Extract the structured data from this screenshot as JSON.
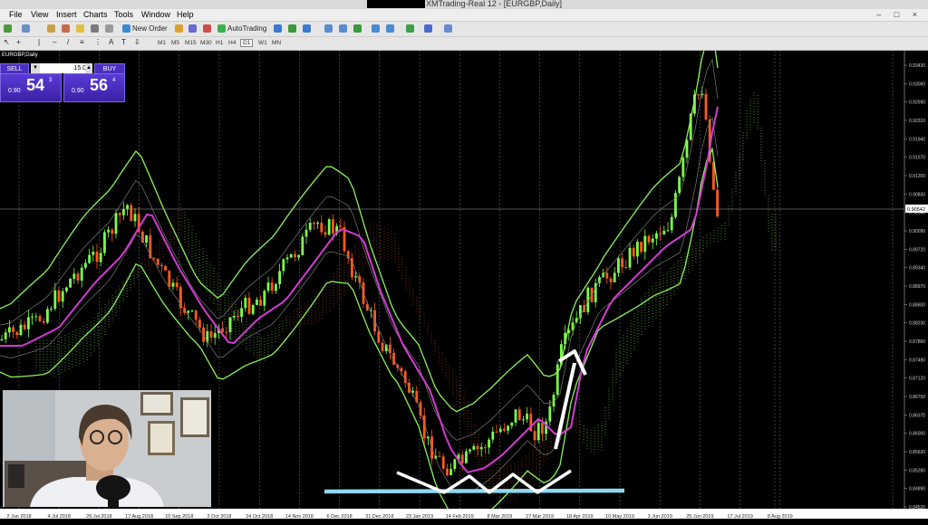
{
  "window": {
    "title": "XMTrading-Real 12 - [EURGBP,Daily]",
    "controls": "– □ ×"
  },
  "menu": [
    "File",
    "View",
    "Insert",
    "Charts",
    "Tools",
    "Window",
    "Help"
  ],
  "toolbar": {
    "new_order": "New Order",
    "autotrading": "AutoTrading",
    "timeframes": [
      "M1",
      "M5",
      "M15",
      "M30",
      "H1",
      "H4",
      "D1",
      "W1",
      "MN"
    ],
    "active_timeframe": "D1"
  },
  "chart": {
    "symbol_label": "EURGBP,Daily",
    "price_axis": [
      "0.93430",
      "0.93060",
      "0.92690",
      "0.92310",
      "0.91940",
      "0.91570",
      "0.91200",
      "0.90830",
      "0.90540",
      "0.90090",
      "0.89720",
      "0.89340",
      "0.88970",
      "0.88600",
      "0.88230",
      "0.87860",
      "0.87490",
      "0.87120",
      "0.86750",
      "0.86370",
      "0.86000",
      "0.85630",
      "0.85260",
      "0.84890",
      "0.84520"
    ],
    "current_price": "0.90542",
    "date_axis": [
      "2 Jun 2018",
      "4 Jul 2018",
      "26 Jul 2018",
      "17 Aug 2018",
      "10 Sep 2018",
      "2 Oct 2018",
      "24 Oct 2018",
      "14 Nov 2018",
      "6 Dec 2018",
      "31 Dec 2018",
      "23 Jan 2019",
      "14 Feb 2019",
      "8 Mar 2019",
      "27 Mar 2019",
      "18 Apr 2019",
      "10 May 2019",
      "3 Jun 2019",
      "25 Jun 2019",
      "17 Jul 2019",
      "8 Aug 2019"
    ],
    "colors": {
      "bull": "#7dff4a",
      "bear": "#ff5a1e",
      "bands": "#8cf25a",
      "ma": "#d23cd2",
      "ichimoku_bull": "#5a9a3c",
      "ichimoku_bear": "#8a3a1a",
      "support": "#8fd8f0",
      "arrow": "#ffffff"
    }
  },
  "trade_panel": {
    "sell_label": "SELL",
    "buy_label": "BUY",
    "lot": "15.00",
    "sell_prefix": "0.90",
    "sell_big": "54",
    "sell_sup": "3",
    "buy_prefix": "0.90",
    "buy_big": "56",
    "buy_sup": "4"
  }
}
